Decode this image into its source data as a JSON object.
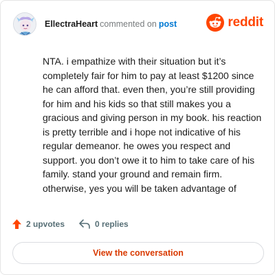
{
  "header": {
    "username": "EllectraHeart",
    "verb": "commented on",
    "target": "post"
  },
  "brand": {
    "name": "reddit",
    "icon": "reddit-snoo-icon",
    "color": "#ff4500"
  },
  "avatar": {
    "icon": "user-avatar-illustration"
  },
  "comment": {
    "text": "NTA. i empathize with their situation but it’s completely fair for him to pay at least $1200 since he can afford that. even then, you’re still providing for him and his kids so that still makes you a gracious and giving person in my book. his reaction is pretty terrible and i hope not indicative of his regular demeanor. he owes you respect and support. you don’t owe it to him to take care of his family. stand your ground and remain firm. otherwise, yes you will be taken advantage of"
  },
  "actions": {
    "upvotes": "2 upvotes",
    "upvote_icon": "upvote-arrow-icon",
    "upvote_color": "#ff4500",
    "replies": "0 replies",
    "reply_icon": "reply-arrow-icon"
  },
  "cta": {
    "label": "View the conversation",
    "color": "#d93a00"
  }
}
